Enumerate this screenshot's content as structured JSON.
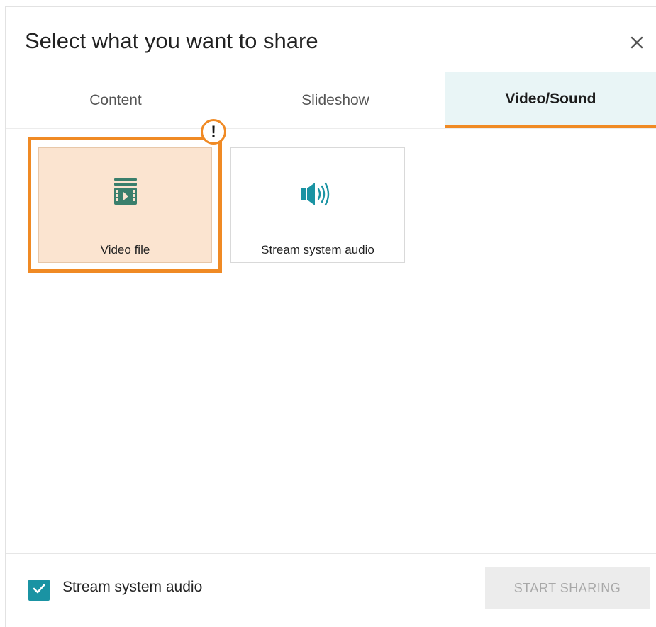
{
  "dialog": {
    "title": "Select what you want to share",
    "close_icon": "close-icon"
  },
  "tabs": [
    {
      "label": "Content",
      "active": false
    },
    {
      "label": "Slideshow",
      "active": false
    },
    {
      "label": "Video/Sound",
      "active": true
    }
  ],
  "options": [
    {
      "label": "Video file",
      "icon": "video-file-icon",
      "selected": true,
      "warning": true
    },
    {
      "label": "Stream system audio",
      "icon": "speaker-icon",
      "selected": false
    }
  ],
  "warning_badge": {
    "text": "!"
  },
  "footer": {
    "checkbox_label": "Stream system audio",
    "checkbox_checked": true,
    "start_button_label": "START SHARING",
    "start_button_enabled": false
  },
  "colors": {
    "accent_orange": "#f08a24",
    "teal": "#1a93a3",
    "icon_green": "#3a7f6c",
    "selected_tile_bg": "#fbe4d0",
    "active_tab_bg": "#e9f5f6"
  }
}
